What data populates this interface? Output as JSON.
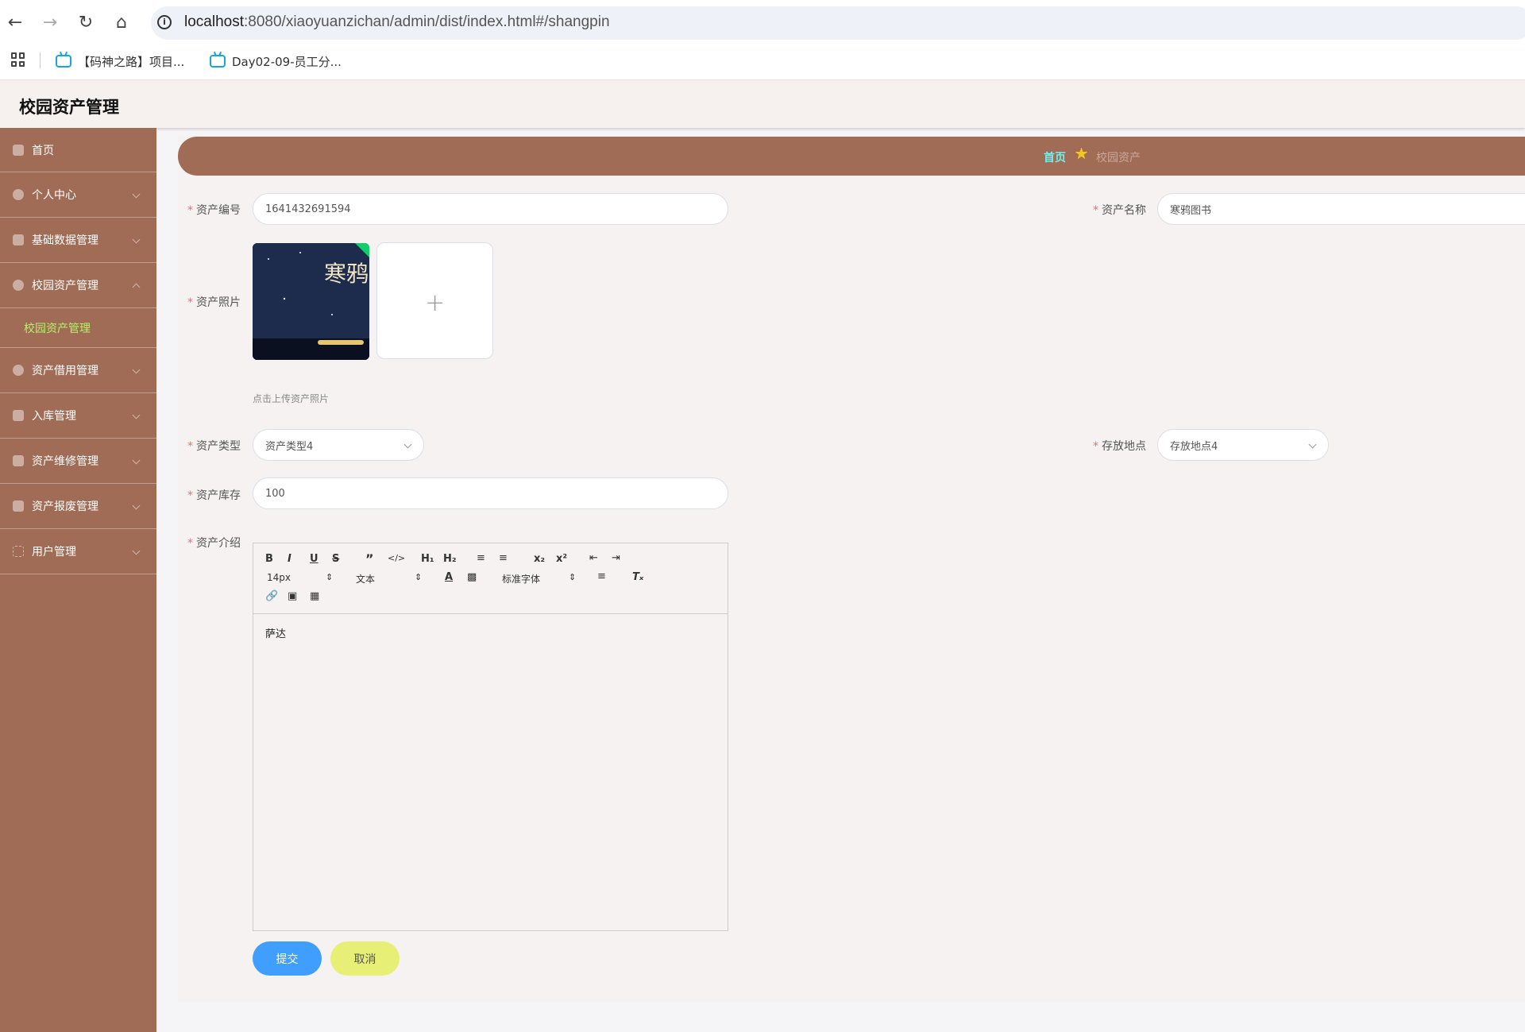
{
  "browser": {
    "url_host": "localhost",
    "url_rest": ":8080/xiaoyuanzichan/admin/dist/index.html#/shangpin",
    "bookmarks": [
      "【码神之路】项目...",
      "Day02-09-员工分..."
    ]
  },
  "app": {
    "title": "校园资产管理"
  },
  "sidebar": {
    "items": [
      {
        "label": "首页"
      },
      {
        "label": "个人中心"
      },
      {
        "label": "基础数据管理"
      },
      {
        "label": "校园资产管理"
      },
      {
        "label": "资产借用管理"
      },
      {
        "label": "入库管理"
      },
      {
        "label": "资产维修管理"
      },
      {
        "label": "资产报废管理"
      },
      {
        "label": "用户管理"
      }
    ],
    "active_sub": "校园资产管理"
  },
  "breadcrumb": {
    "home": "首页",
    "current": "校园资产"
  },
  "form": {
    "code_label": "资产编号",
    "code_value": "1641432691594",
    "name_label": "资产名称",
    "name_value": "寒鸦图书",
    "photo_label": "资产照片",
    "photo_hint": "点击上传资产照片",
    "type_label": "资产类型",
    "type_value": "资产类型4",
    "location_label": "存放地点",
    "location_value": "存放地点4",
    "stock_label": "资产库存",
    "stock_value": "100",
    "intro_label": "资产介绍",
    "intro_value": "萨达"
  },
  "editor": {
    "font_size": "14px",
    "block_type": "文本",
    "font_family": "标准字体"
  },
  "buttons": {
    "submit": "提交",
    "cancel": "取消"
  },
  "cover_text": "寒鸦",
  "colors": {
    "sidebar_bg": "#a06c55",
    "submit": "#409eff",
    "cancel": "#e8ef77",
    "active_sub": "#b5f06a"
  }
}
